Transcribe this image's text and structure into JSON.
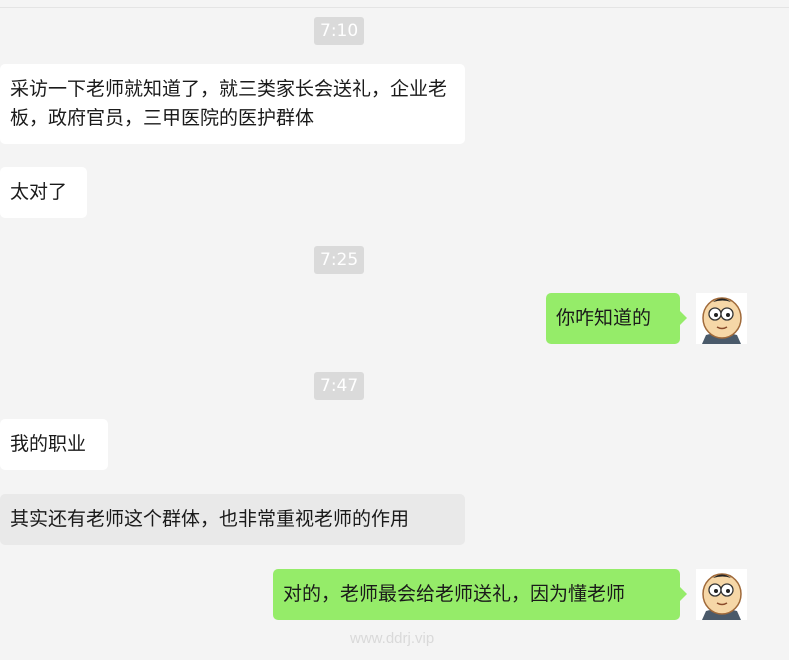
{
  "chat": {
    "messages": [
      {
        "type": "time",
        "text": "7:10"
      },
      {
        "type": "message",
        "side": "left",
        "text": "采访一下老师就知道了，就三类家长会送礼，企业老板，政府官员，三甲医院的医护群体"
      },
      {
        "type": "message",
        "side": "left",
        "text": "太对了"
      },
      {
        "type": "time",
        "text": "7:25"
      },
      {
        "type": "message",
        "side": "right",
        "text": "你咋知道的",
        "avatar": "cartoon-boy-avatar"
      },
      {
        "type": "time",
        "text": "7:47"
      },
      {
        "type": "message",
        "side": "left",
        "text": "我的职业"
      },
      {
        "type": "message",
        "side": "left",
        "text": "其实还有老师这个群体，也非常重视老师的作用"
      },
      {
        "type": "message",
        "side": "right",
        "text": "对的，老师最会给老师送礼，因为懂老师",
        "avatar": "cartoon-boy-avatar"
      }
    ]
  },
  "watermark": "www.ddrj.vip",
  "colors": {
    "background": "#f4f4f4",
    "incoming_bubble": "#ffffff",
    "outgoing_bubble": "#95ec69",
    "time_badge": "#dadada"
  }
}
